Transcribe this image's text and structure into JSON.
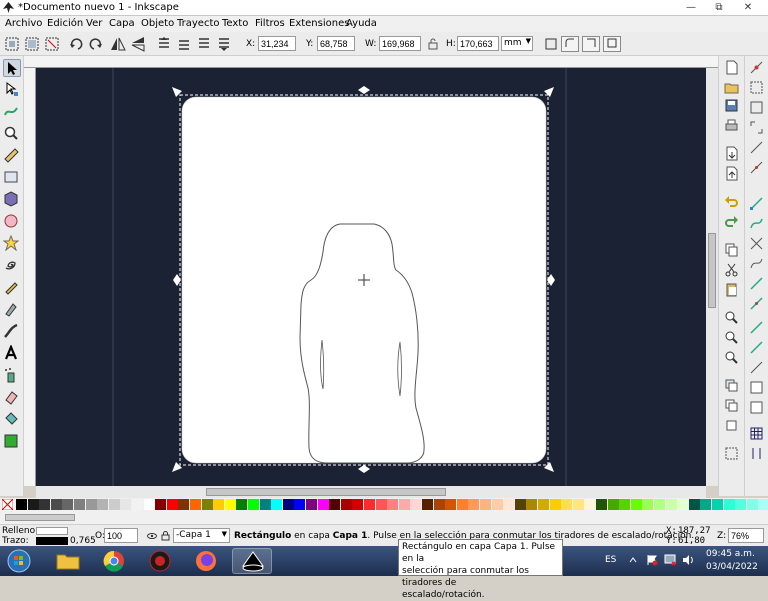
{
  "window": {
    "title": "*Documento nuevo 1 - Inkscape",
    "controls": [
      "—",
      "⧉",
      "✕"
    ]
  },
  "menu": [
    "Archivo",
    "Edición",
    "Ver",
    "Capa",
    "Objeto",
    "Trayecto",
    "Texto",
    "Filtros",
    "Extensiones",
    "Ayuda"
  ],
  "toolbar": {
    "x_label": "X:",
    "x_value": "31,234",
    "y_label": "Y:",
    "y_value": "68,758",
    "w_label": "W:",
    "w_value": "169,968",
    "h_label": "H:",
    "h_value": "170,663",
    "unit": "mm"
  },
  "status": {
    "fill_label": "Relleno:",
    "stroke_label": "Trazo:",
    "stroke_width": "0,765",
    "opacity_label": "O:",
    "opacity_value": "100",
    "layer": "-Capa 1",
    "message_bold": "Rectángulo",
    "message_rest": " en capa ",
    "message_layer": "Capa 1",
    "message_tail": ". Pulse en la selección para conmutar los tiradores de escalado/rotación.",
    "coord_x_label": "X:",
    "coord_x": "187,27",
    "coord_y_label": "Y:",
    "coord_y": "61,80",
    "zoom_label": "Z:",
    "zoom": "76%"
  },
  "tooltip": {
    "line1": "Rectángulo  en capa Capa 1. Pulse en la",
    "line2": "selección para conmutar los tiradores de",
    "line3": "escalado/rotación."
  },
  "taskbar": {
    "lang": "ES",
    "time": "09:45 a.m.",
    "date": "03/04/2022"
  },
  "palette_colors": [
    "#000000",
    "#1a1a1a",
    "#333333",
    "#4d4d4d",
    "#666666",
    "#808080",
    "#999999",
    "#b3b3b3",
    "#cccccc",
    "#e6e6e6",
    "#f2f2f2",
    "#ffffff",
    "#800000",
    "#ff0000",
    "#803300",
    "#ff6600",
    "#808000",
    "#ffcc00",
    "#ffff00",
    "#008000",
    "#00ff00",
    "#008080",
    "#00ffff",
    "#000080",
    "#0000ff",
    "#800080",
    "#ff00ff",
    "#550000",
    "#aa0000",
    "#d40000",
    "#ff2a2a",
    "#ff5555",
    "#ff8080",
    "#ffaaaa",
    "#ffd5d5",
    "#552200",
    "#aa4400",
    "#d45500",
    "#ff7f2a",
    "#ff9955",
    "#ffb380",
    "#ffccaa",
    "#ffe6d5",
    "#554400",
    "#aa8800",
    "#d4aa00",
    "#ffcc00",
    "#ffdd55",
    "#ffe680",
    "#fff6d5",
    "#225500",
    "#44aa00",
    "#55d400",
    "#66ff00",
    "#99ff55",
    "#b3ff80",
    "#ccffaa",
    "#e5ffd5",
    "#005544",
    "#00aa88",
    "#00d4aa",
    "#2affd5",
    "#55ffdd",
    "#80ffe6",
    "#aafff6"
  ],
  "icons": {
    "app": "inkscape-icon",
    "tools": [
      "selector-tool-icon",
      "node-tool-icon",
      "tweak-tool-icon",
      "zoom-tool-icon",
      "measure-tool-icon",
      "rect-tool-icon",
      "3dbox-tool-icon",
      "ellipse-tool-icon",
      "star-tool-icon",
      "spiral-tool-icon",
      "pencil-tool-icon",
      "pen-tool-icon",
      "calligraphy-tool-icon",
      "text-tool-icon",
      "spray-tool-icon",
      "eraser-tool-icon",
      "bucket-tool-icon",
      "gradient-tool-icon"
    ]
  }
}
